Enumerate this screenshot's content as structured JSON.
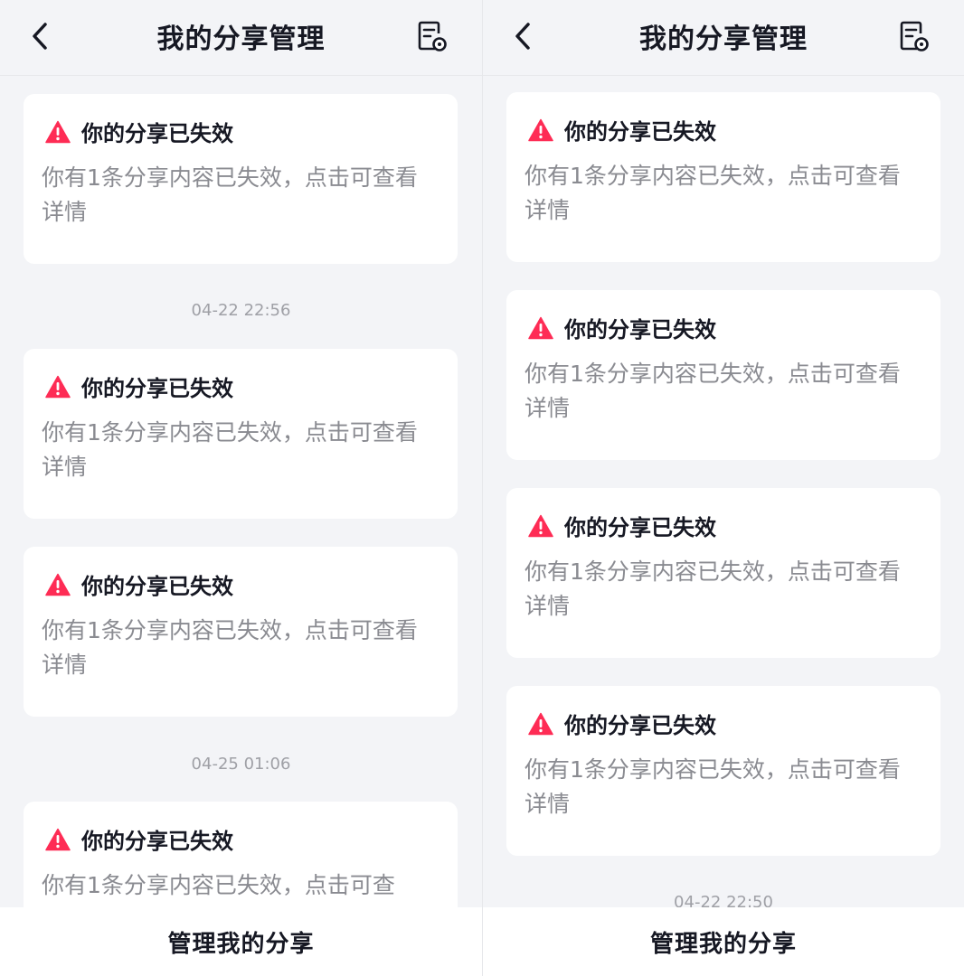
{
  "screens": [
    {
      "header": {
        "title": "我的分享管理"
      },
      "items": [
        {
          "title": "你的分享已失效",
          "desc": "你有1条分享内容已失效，点击可查看详情"
        },
        {
          "timestamp": "04-22 22:56"
        },
        {
          "title": "你的分享已失效",
          "desc": "你有1条分享内容已失效，点击可查看详情"
        },
        {
          "title": "你的分享已失效",
          "desc": "你有1条分享内容已失效，点击可查看详情"
        },
        {
          "timestamp": "04-25 01:06"
        },
        {
          "title": "你的分享已失效",
          "desc": "你有1条分享内容已失效，点击可查"
        }
      ],
      "bottom_button": "管理我的分享"
    },
    {
      "header": {
        "title": "我的分享管理"
      },
      "items": [
        {
          "title": "你的分享已失效",
          "desc": "你有1条分享内容已失效，点击可查看详情"
        },
        {
          "title": "你的分享已失效",
          "desc": "你有1条分享内容已失效，点击可查看详情"
        },
        {
          "title": "你的分享已失效",
          "desc": "你有1条分享内容已失效，点击可查看详情"
        },
        {
          "title": "你的分享已失效",
          "desc": "你有1条分享内容已失效，点击可查看详情"
        },
        {
          "timestamp": "04-22 22:50"
        }
      ],
      "bottom_button": "管理我的分享"
    }
  ],
  "icons": {
    "back": "chevron-left-icon",
    "records": "document-settings-icon",
    "warning": "warning-triangle-icon"
  },
  "colors": {
    "background": "#f3f4f7",
    "card": "#ffffff",
    "warning": "#fe2c55",
    "title_text": "#161823",
    "desc_text": "#8a8b91",
    "timestamp_text": "#9fa0a6"
  }
}
